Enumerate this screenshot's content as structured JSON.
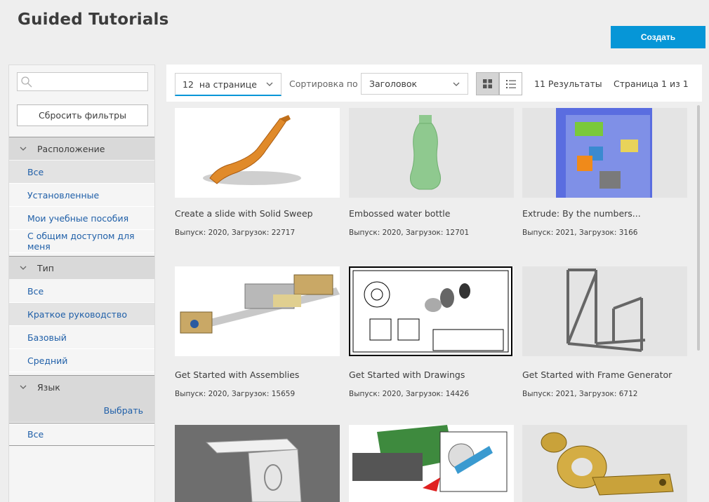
{
  "header": {
    "title": "Guided Tutorials",
    "create_label": "Создать"
  },
  "sidebar": {
    "search": {
      "placeholder": ""
    },
    "reset_label": "Сбросить фильтры",
    "location": {
      "label": "Расположение",
      "items": [
        "Все",
        "Установленные",
        "Мои учебные пособия",
        "С общим доступом для меня"
      ]
    },
    "type": {
      "label": "Тип",
      "items": [
        "Все",
        "Краткое руководство",
        "Базовый",
        "Средний"
      ]
    },
    "language": {
      "label": "Язык",
      "choose_label": "Выбрать",
      "items": [
        "Все"
      ]
    }
  },
  "toolbar": {
    "per_page": "12  на странице",
    "sort_label": "Сортировка по",
    "sort_value": "Заголовок",
    "results": "11 Результаты",
    "pages": "Страница 1 из 1"
  },
  "cards": [
    {
      "title": "Create a slide with Solid Sweep",
      "meta": "Выпуск: 2020, Загрузок: 22717",
      "icon": "slide-thumbnail"
    },
    {
      "title": "Embossed water bottle",
      "meta": "Выпуск: 2020, Загрузок: 12701",
      "icon": "bottle-thumbnail"
    },
    {
      "title": "Extrude: By the numbers...",
      "meta": "Выпуск: 2021, Загрузок: 3166",
      "icon": "numbers-thumbnail"
    },
    {
      "title": "Get Started with Assemblies",
      "meta": "Выпуск: 2020, Загрузок: 15659",
      "icon": "assembly-thumbnail"
    },
    {
      "title": "Get Started with Drawings",
      "meta": "Выпуск: 2020, Загрузок: 14426",
      "icon": "drawing-thumbnail"
    },
    {
      "title": "Get Started with Frame Generator",
      "meta": "Выпуск: 2021, Загрузок: 6712",
      "icon": "frame-thumbnail"
    },
    {
      "title": "",
      "meta": "",
      "icon": "sheetmetal-thumbnail"
    },
    {
      "title": "",
      "meta": "",
      "icon": "machine-thumbnail"
    },
    {
      "title": "",
      "meta": "",
      "icon": "bracket-thumbnail"
    }
  ],
  "colors": {
    "accent": "#0696d7",
    "link": "#1f5fa8"
  }
}
